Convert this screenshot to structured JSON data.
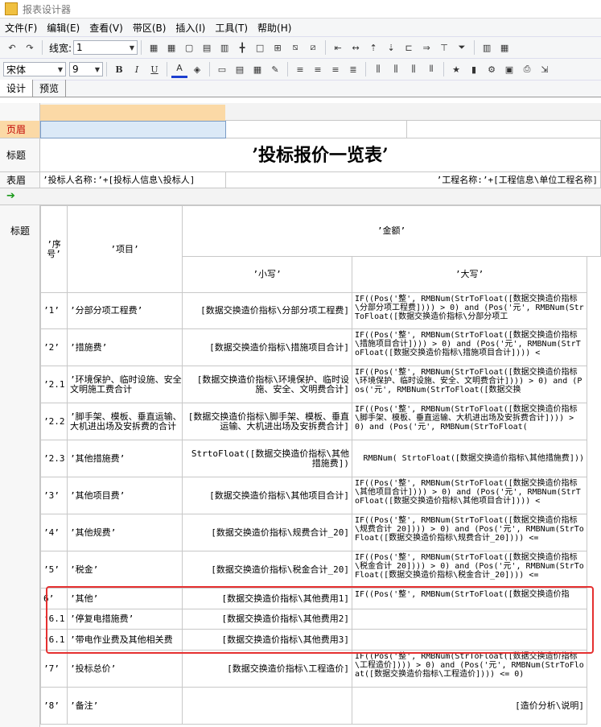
{
  "window": {
    "title": "报表设计器"
  },
  "menu": [
    "文件(F)",
    "编辑(E)",
    "查看(V)",
    "带区(B)",
    "插入(I)",
    "工具(T)",
    "帮助(H)"
  ],
  "toolbar1": {
    "line_width_label": "线宽:",
    "line_width_value": "1"
  },
  "toolbar2": {
    "font_name": "宋体",
    "font_size": "9"
  },
  "tabs": [
    "设计",
    "预览"
  ],
  "bands": {
    "page_header": "页眉",
    "title": "标题",
    "table_header": "表眉",
    "col_title": "标题"
  },
  "report": {
    "title": "’投标报价一览表’",
    "bidder": "’投标人名称:’+[投标人信息\\投标人]",
    "project": "’工程名称:’+[工程信息\\单位工程名称]",
    "headers": {
      "seq": "’序号’",
      "item": "’项目’",
      "amount": "’金额’",
      "lower": "’小写’",
      "upper": "’大写’"
    },
    "rows": [
      {
        "seq": "’1’",
        "item": "’分部分项工程费’",
        "lower": "[数据交换造价指标\\分部分项工程费]",
        "upper": "IF((Pos('整', RMBNum(StrToFloat([数据交换造价指标\\分部分项工程费]))) > 0) and (Pos('元', RMBNum(StrToFloat([数据交换造价指标\\分部分项工"
      },
      {
        "seq": "’2’",
        "item": "’措施费’",
        "lower": "[数据交换造价指标\\措施项目合计]",
        "upper": "IF((Pos('整', RMBNum(StrToFloat([数据交换造价指标\\措施项目合计]))) > 0) and (Pos('元', RMBNum(StrToFloat([数据交换造价指标\\措施项目合计]))) <"
      },
      {
        "seq": "’2.1",
        "item": "’环境保护、临时设施、安全文明施工费合计",
        "lower": "[数据交换造价指标\\环境保护、临时设施、安全、文明费合计]",
        "upper": "IF((Pos('整', RMBNum(StrToFloat([数据交换造价指标\\环境保护、临时设施、安全、文明费合计]))) > 0) and (Pos('元', RMBNum(StrToFloat([数据交换"
      },
      {
        "seq": "’2.2",
        "item": "’脚手架、模板、垂直运输、大机进出场及安拆费的合计",
        "lower": "[数据交换造价指标\\脚手架、模板、垂直运输、大机进出场及安拆费合计]",
        "upper": "IF((Pos('整', RMBNum(StrToFloat([数据交换造价指标\\脚手架、模板、垂直运输、大机进出场及安拆费合计]))) > 0) and (Pos('元', RMBNum(StrToFloat("
      },
      {
        "seq": "’2.3",
        "item": "’其他措施费’",
        "lower": "StrtoFloat([数据交换造价指标\\其他措施费])",
        "upper": "RMBNum( StrtoFloat([数据交换造价指标\\其他措施费]))"
      },
      {
        "seq": "’3’",
        "item": "’其他项目费’",
        "lower": "[数据交换造价指标\\其他项目合计]",
        "upper": "IF((Pos('整', RMBNum(StrToFloat([数据交换造价指标\\其他项目合计]))) > 0) and (Pos('元', RMBNum(StrToFloat([数据交换造价指标\\其他项目合计]))) <"
      },
      {
        "seq": "’4’",
        "item": "’其他规费’",
        "lower": "[数据交换造价指标\\规费合计_20]",
        "upper": "IF((Pos('整', RMBNum(StrToFloat([数据交换造价指标\\规费合计_20]))) > 0) and (Pos('元', RMBNum(StrToFloat([数据交换造价指标\\规费合计_20]))) <="
      },
      {
        "seq": "’5’",
        "item": "’税金’",
        "lower": "[数据交换造价指标\\税金合计_20]",
        "upper": "IF((Pos('整', RMBNum(StrToFloat([数据交换造价指标\\税金合计_20]))) > 0) and (Pos('元', RMBNum(StrToFloat([数据交换造价指标\\税金合计_20]))) <="
      },
      {
        "seq": "6’",
        "item": "’其他’",
        "lower": "[数据交换造价指标\\其他费用1]",
        "upper": "IF((Pos('整', RMBNum(StrToFloat([数据交换造价指"
      },
      {
        "seq": "’6.1",
        "item": "’停复电措施费’",
        "lower": "[数据交换造价指标\\其他费用2]",
        "upper": ""
      },
      {
        "seq": "’6.1",
        "item": "’带电作业费及其他相关费",
        "lower": "[数据交换造价指标\\其他费用3]",
        "upper": ""
      },
      {
        "seq": "’7’",
        "item": "’投标总价’",
        "lower": "[数据交换造价指标\\工程造价]",
        "upper": "IF((Pos('整', RMBNum(StrToFloat([数据交换造价指标\\工程造价]))) > 0) and (Pos('元', RMBNum(StrToFloat([数据交换造价指标\\工程造价]))) <= 0)"
      },
      {
        "seq": "’8’",
        "item": "’备注’",
        "lower": "",
        "upper": "[造价分析\\说明]"
      }
    ]
  },
  "colors": {
    "highlight": "#e53030",
    "page_header_fill": "#dbe9f7",
    "ruler_fill": "#fbd9a6"
  }
}
